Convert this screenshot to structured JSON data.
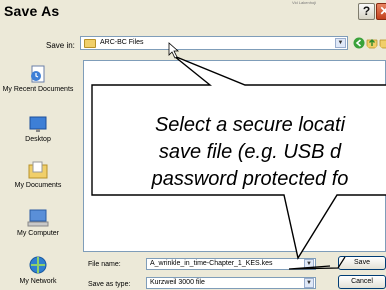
{
  "window": {
    "title": "Save As",
    "title_fragment": "Vid Lakenhoji"
  },
  "toolbar": {
    "save_in_label": "Save in:",
    "save_in_value": "ARC-BC Files",
    "icons": [
      "back-icon",
      "up-folder-icon",
      "new-folder-icon",
      "views-menu-icon"
    ]
  },
  "places": [
    {
      "label": "My Recent Documents",
      "icon": "recent-documents-icon"
    },
    {
      "label": "Desktop",
      "icon": "desktop-icon"
    },
    {
      "label": "My Documents",
      "icon": "my-documents-icon"
    },
    {
      "label": "My Computer",
      "icon": "my-computer-icon"
    },
    {
      "label": "My Network",
      "icon": "my-network-icon"
    }
  ],
  "form": {
    "file_name_label": "File name:",
    "file_name_value": "A_wrinkle_in_time-Chapter_1_KES.kes",
    "save_as_type_label": "Save as type:",
    "save_as_type_value": "Kurzweil 3000 file"
  },
  "buttons": {
    "save": "Save",
    "cancel": "Cancel"
  },
  "callout": {
    "text": "Select a secure locati\nsave file (e.g. USB d\npassword protected fo"
  },
  "colors": {
    "dialog_bg": "#ece9d8",
    "close_button": "#c2401d",
    "input_border": "#7f9db9",
    "button_border": "#003c74"
  }
}
